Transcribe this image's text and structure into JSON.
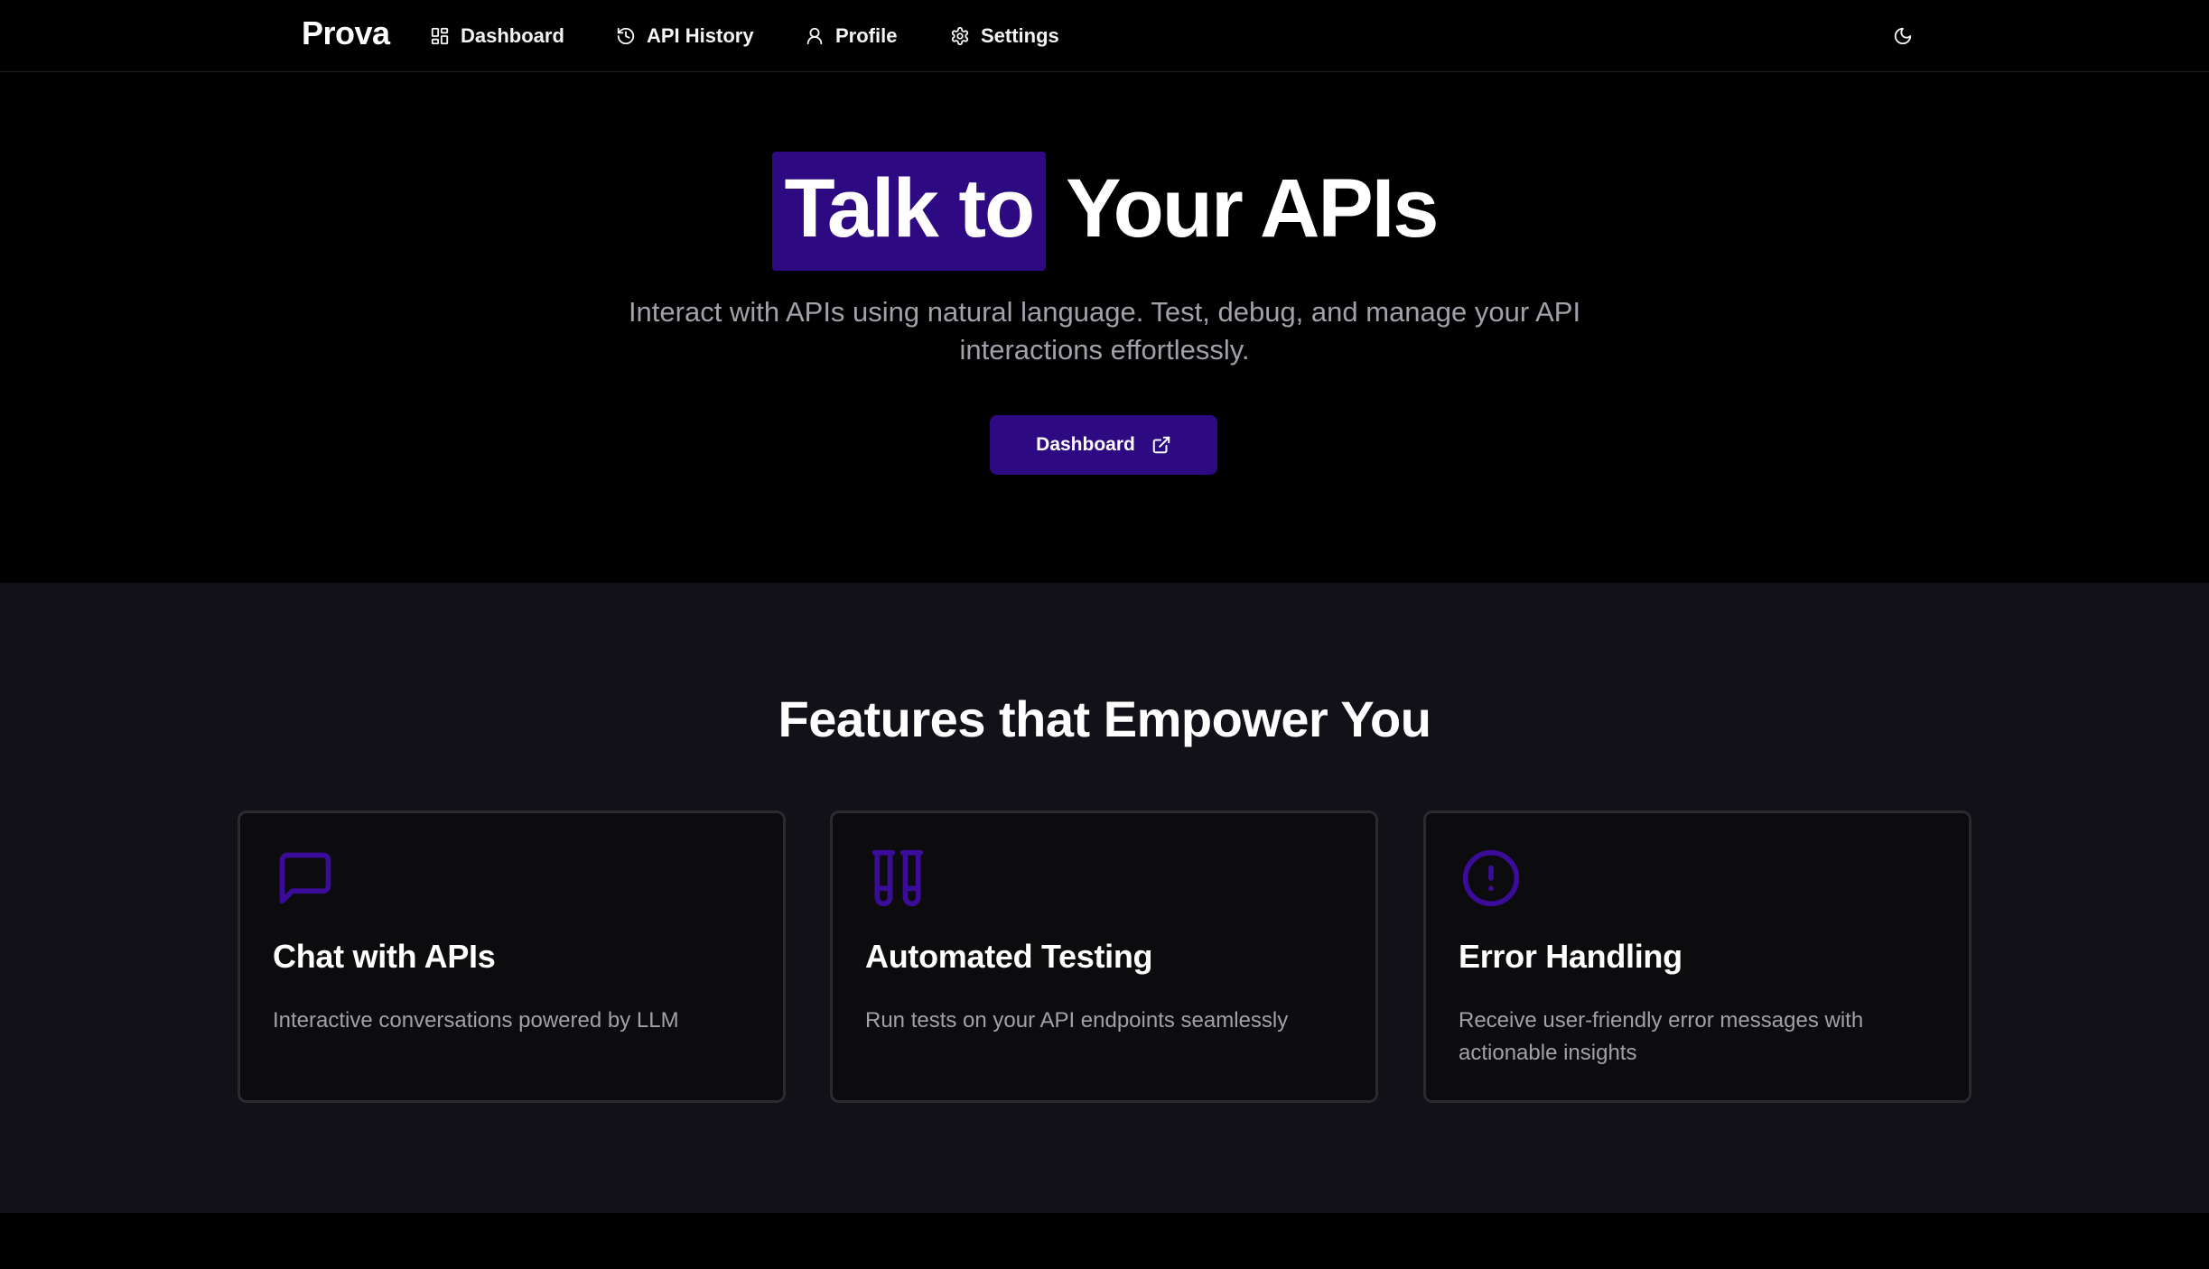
{
  "nav": {
    "brand": "Prova",
    "items": [
      {
        "label": "Dashboard",
        "icon": "dashboard-icon"
      },
      {
        "label": "API History",
        "icon": "history-icon"
      },
      {
        "label": "Profile",
        "icon": "user-icon"
      },
      {
        "label": "Settings",
        "icon": "gear-icon"
      }
    ],
    "theme_toggle_icon": "moon-icon"
  },
  "hero": {
    "title_highlight": "Talk to",
    "title_rest": "Your APIs",
    "subtitle": "Interact with APIs using natural language. Test, debug, and manage your API interactions effortlessly.",
    "cta_label": "Dashboard",
    "cta_icon": "external-link-icon"
  },
  "features": {
    "title": "Features that Empower You",
    "cards": [
      {
        "icon": "chat-icon",
        "title": "Chat with APIs",
        "description": "Interactive conversations powered by LLM"
      },
      {
        "icon": "test-tubes-icon",
        "title": "Automated Testing",
        "description": "Run tests on your API endpoints seamlessly"
      },
      {
        "icon": "alert-circle-icon",
        "title": "Error Handling",
        "description": "Receive user-friendly error messages with actionable insights"
      }
    ]
  },
  "colors": {
    "accent": "#2e0a82",
    "icon_accent": "#3b0c9a",
    "background": "#000000",
    "section_background": "#121117",
    "muted_text": "#a1a1aa"
  }
}
